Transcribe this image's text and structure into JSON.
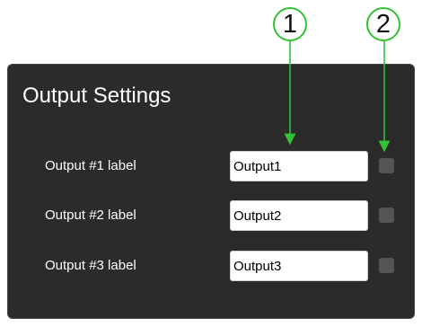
{
  "callouts": [
    "1",
    "2"
  ],
  "panel": {
    "title": "Output Settings",
    "rows": [
      {
        "label": "Output #1 label",
        "value": "Output1",
        "checked": false
      },
      {
        "label": "Output #2 label",
        "value": "Output2",
        "checked": false
      },
      {
        "label": "Output #3 label",
        "value": "Output3",
        "checked": false
      }
    ]
  },
  "colors": {
    "callout_green": "#33c233",
    "panel_bg": "#2b2b2b",
    "checkbox_bg": "#555555"
  }
}
